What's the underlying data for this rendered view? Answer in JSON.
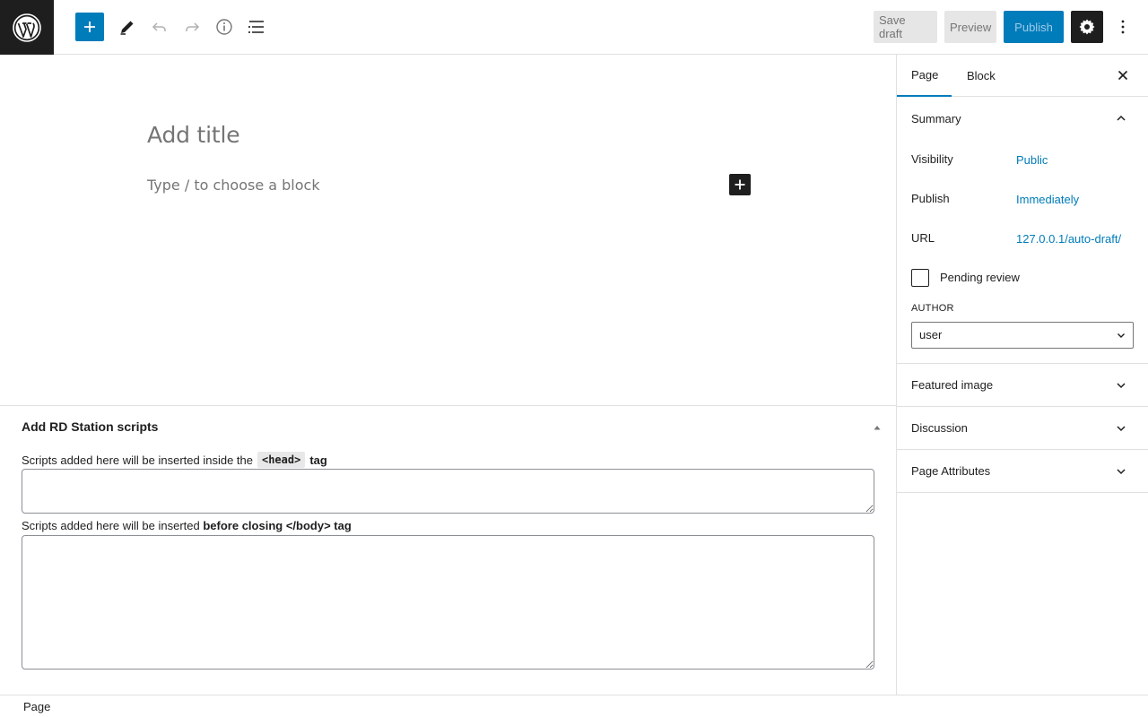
{
  "topbar": {
    "logo": "wordpress-logo",
    "add_block_icon": "plus-icon",
    "tools_icon": "pencil-icon",
    "undo_icon": "undo-icon",
    "redo_icon": "redo-icon",
    "details_icon": "info-icon",
    "list_view_icon": "list-view-icon",
    "save_draft": "Save draft",
    "preview": "Preview",
    "publish": "Publish",
    "settings_icon": "gear-icon",
    "options_icon": "more-vertical-icon"
  },
  "editor": {
    "title_placeholder": "Add title",
    "block_placeholder": "Type / to choose a block"
  },
  "metabox": {
    "title": "Add RD Station scripts",
    "head_label_prefix": "Scripts added here will be inserted inside the",
    "head_label_code": "<head>",
    "head_label_suffix": "tag",
    "body_label_prefix": "Scripts added here will be inserted",
    "body_label_bold": "before closing </body> tag",
    "head_value": "",
    "body_value": ""
  },
  "sidebar": {
    "tabs": [
      {
        "label": "Page",
        "active": true
      },
      {
        "label": "Block",
        "active": false
      }
    ],
    "summary": {
      "title": "Summary",
      "visibility_label": "Visibility",
      "visibility_value": "Public",
      "publish_label": "Publish",
      "publish_value": "Immediately",
      "url_label": "URL",
      "url_value": "127.0.0.1/auto-draft/",
      "pending_label": "Pending review",
      "pending_checked": false,
      "author_label": "AUTHOR",
      "author_value": "user"
    },
    "panels": [
      {
        "label": "Featured image"
      },
      {
        "label": "Discussion"
      },
      {
        "label": "Page Attributes"
      }
    ]
  },
  "footer": {
    "breadcrumb": "Page"
  },
  "colors": {
    "accent": "#007cba",
    "dark": "#1e1e1e",
    "border": "#e0e0e0"
  }
}
